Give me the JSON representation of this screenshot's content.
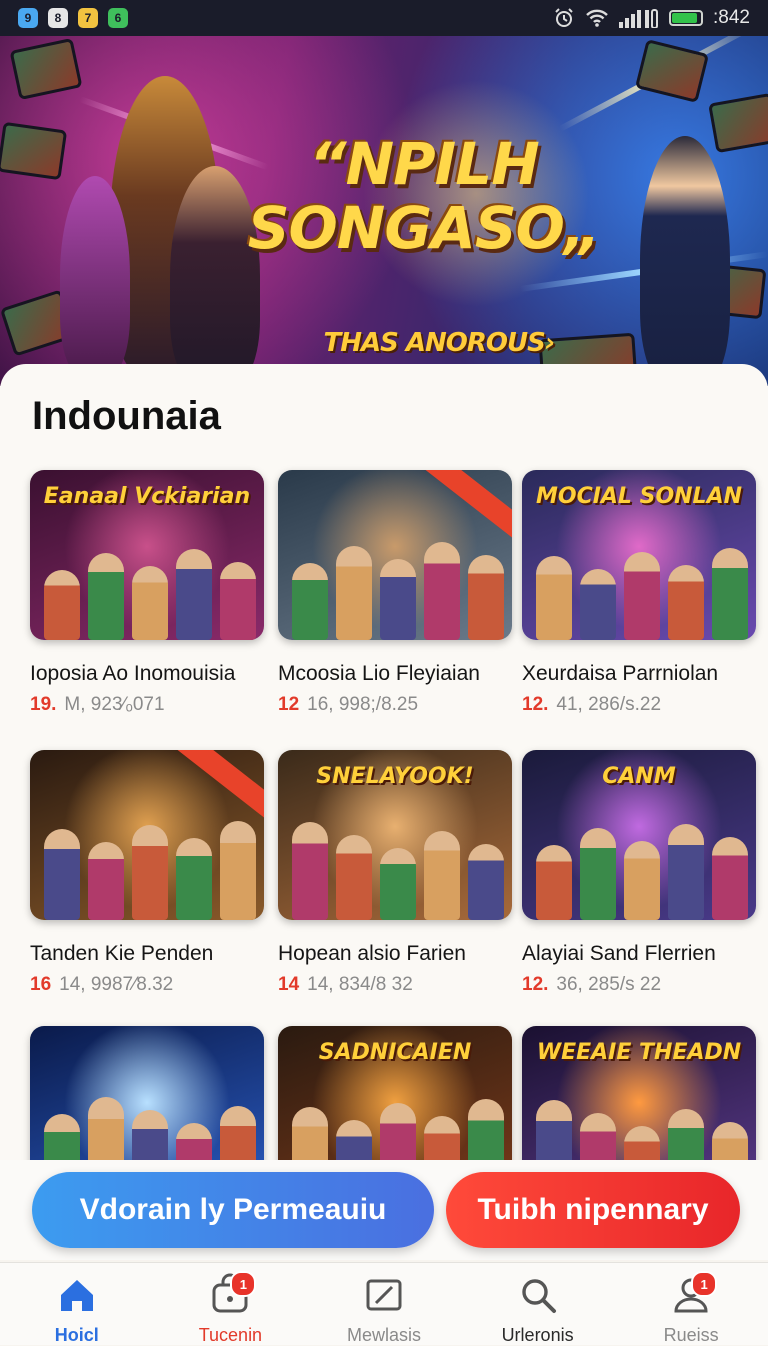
{
  "status_bar": {
    "apps": [
      {
        "icon": "map-pin-icon",
        "glyph": "9",
        "color": "#4aa8f0"
      },
      {
        "icon": "app-icon-1",
        "glyph": "8",
        "color": "#e6e6e6"
      },
      {
        "icon": "app-icon-2",
        "glyph": "7",
        "color": "#f2c340"
      },
      {
        "icon": "app-icon-3",
        "glyph": "6",
        "color": "#3fbf5c"
      }
    ],
    "icons": [
      "alarm-icon",
      "wifi-icon",
      "signal-icon",
      "battery-icon"
    ],
    "battery_level": 0.9,
    "time": ":842"
  },
  "hero": {
    "title_line1": "“NPILH",
    "title_line2": "SONGASO„",
    "subtitle": "THAS ANOROUS›"
  },
  "section": {
    "title": "Indounaia"
  },
  "cards": [
    {
      "thumb_text": "Eanaal Vckiarian",
      "title": "Ioposia Ao Inomouisia",
      "rank": "19.",
      "meta": "M, 923⁄ₒ071",
      "theme": "purple",
      "ribbon": false
    },
    {
      "thumb_text": "",
      "title": "Mcoosia Lio Fleyiaian",
      "rank": "12",
      "meta": "16, 998;/8.25",
      "theme": "city",
      "ribbon": true
    },
    {
      "thumb_text": "MOCIAL SONLAN",
      "title": "Xeurdaisa Parrniolan",
      "rank": "12.",
      "meta": "41, 286/s.22",
      "theme": "violet",
      "ribbon": false
    },
    {
      "thumb_text": "",
      "title": "Tanden Kie Penden",
      "rank": "16",
      "meta": "14, 9987⁄8.32",
      "theme": "amber",
      "ribbon": true
    },
    {
      "thumb_text": "SNELAYOOK!",
      "title": "Hopean alsio Farien",
      "rank": "14",
      "meta": "14, 834/8 32",
      "theme": "crowd",
      "ribbon": false
    },
    {
      "thumb_text": "CANM",
      "title": "Alayiai Sand Flerrien",
      "rank": "12.",
      "meta": "36, 285/s 22",
      "theme": "dusk",
      "ribbon": false
    },
    {
      "thumb_text": "",
      "title": "",
      "rank": "",
      "meta": "",
      "theme": "blue",
      "ribbon": false
    },
    {
      "thumb_text": "SADNICAIEN",
      "title": "",
      "rank": "",
      "meta": "",
      "theme": "market",
      "ribbon": false
    },
    {
      "thumb_text": "WEEAIE THEADN",
      "title": "",
      "rank": "",
      "meta": "",
      "theme": "night",
      "ribbon": false
    }
  ],
  "actions": {
    "primary_label": "Vdorain ly Permeauiu",
    "secondary_label": "Tuibh nipennary"
  },
  "nav": [
    {
      "label": "Hoicl",
      "icon": "home-icon",
      "active": true,
      "color": "#2b6fe0",
      "badge": ""
    },
    {
      "label": "Tucenin",
      "icon": "bag-icon",
      "active": false,
      "color": "#e23a2a",
      "badge": "1"
    },
    {
      "label": "Mewlasis",
      "icon": "edit-icon",
      "active": false,
      "color": "#8a8a8a",
      "badge": ""
    },
    {
      "label": "Urleronis",
      "icon": "search-icon",
      "active": false,
      "color": "#2a2a2a",
      "badge": ""
    },
    {
      "label": "Rueiss",
      "icon": "profile-icon",
      "active": false,
      "color": "#8a8a8a",
      "badge": "1"
    }
  ]
}
